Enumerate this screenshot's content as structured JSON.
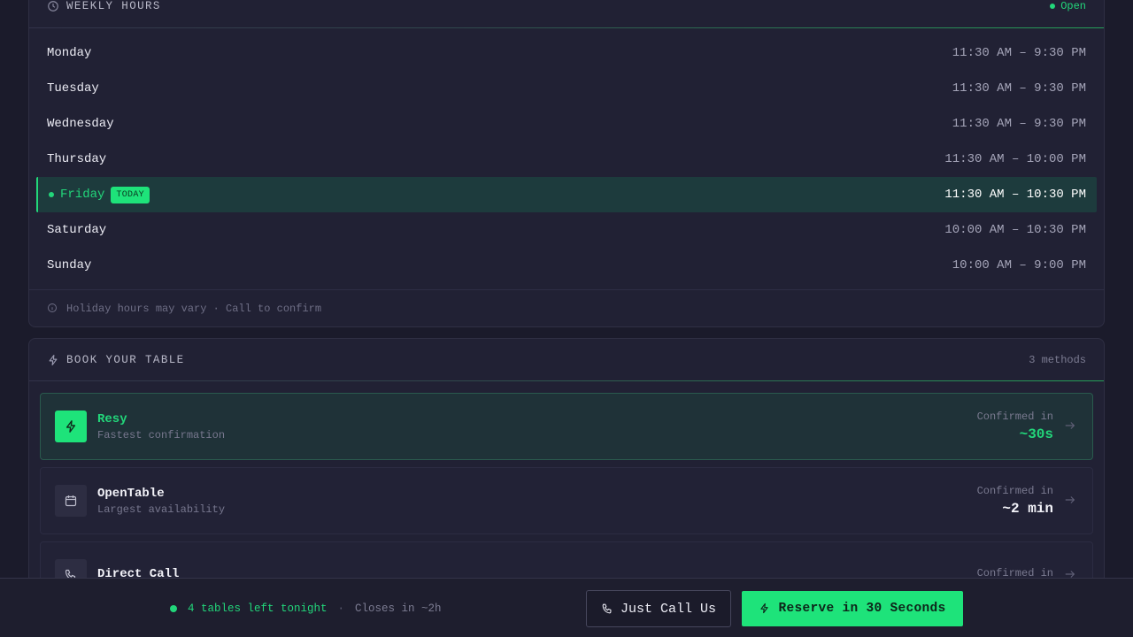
{
  "hours": {
    "title": "WEEKLY HOURS",
    "status": "Open",
    "days": [
      {
        "day": "Monday",
        "time": "11:30 AM – 9:30 PM"
      },
      {
        "day": "Tuesday",
        "time": "11:30 AM – 9:30 PM"
      },
      {
        "day": "Wednesday",
        "time": "11:30 AM – 9:30 PM"
      },
      {
        "day": "Thursday",
        "time": "11:30 AM – 10:00 PM"
      },
      {
        "day": "Friday",
        "time": "11:30 AM – 10:30 PM",
        "badge": "TODAY"
      },
      {
        "day": "Saturday",
        "time": "10:00 AM – 10:30 PM"
      },
      {
        "day": "Sunday",
        "time": "10:00 AM – 9:00 PM"
      }
    ],
    "note": "Holiday hours may vary · Call to confirm"
  },
  "booking": {
    "title": "BOOK YOUR TABLE",
    "count": "3 methods",
    "methods": [
      {
        "name": "Resy",
        "sub": "Fastest confirmation",
        "label": "Confirmed in",
        "value": "~30s",
        "icon": "bolt-icon"
      },
      {
        "name": "OpenTable",
        "sub": "Largest availability",
        "label": "Confirmed in",
        "value": "~2 min",
        "icon": "calendar-icon"
      },
      {
        "name": "Direct Call",
        "sub": "",
        "label": "Confirmed in",
        "value": "",
        "icon": "phone-icon"
      }
    ]
  },
  "bar": {
    "availability": "4 tables left tonight",
    "separator": "·",
    "closes": "Closes in ~2h",
    "call_label": "Just Call Us",
    "reserve_label": "Reserve in 30 Seconds"
  },
  "colors": {
    "accent": "#1ee37a",
    "background": "#1b1b2b",
    "card": "#212134"
  }
}
